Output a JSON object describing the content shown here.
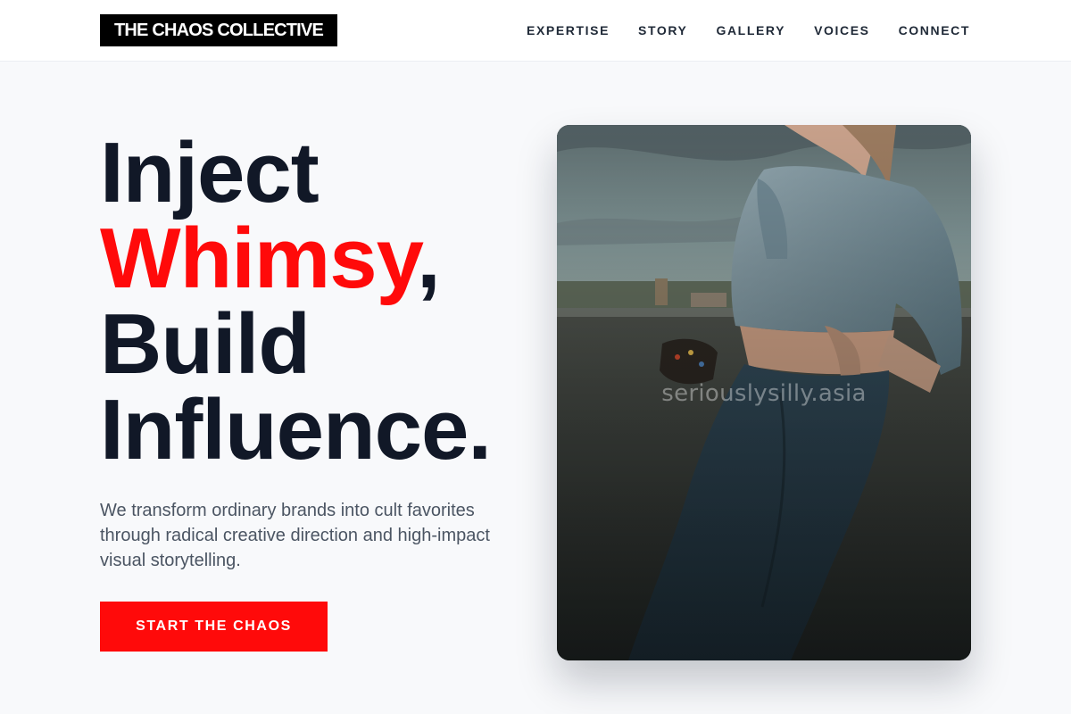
{
  "brand": {
    "name": "THE CHAOS COLLECTIVE"
  },
  "nav": {
    "items": [
      {
        "label": "EXPERTISE"
      },
      {
        "label": "STORY"
      },
      {
        "label": "GALLERY"
      },
      {
        "label": "VOICES"
      },
      {
        "label": "CONNECT"
      }
    ]
  },
  "hero": {
    "line1": "Inject",
    "accent_word": "Whimsy",
    "accent_suffix": ",",
    "line3": "Build",
    "line4": "Influence.",
    "description": "We transform ordinary brands into cult favorites through radical creative direction and high-impact visual storytelling.",
    "cta_label": "START THE CHAOS",
    "image_watermark": "seriouslysilly.asia"
  },
  "colors": {
    "accent": "#ff0a0a",
    "heading": "#111827",
    "body_text": "#4b5563",
    "page_bg": "#f8f9fb",
    "logo_bg": "#000000"
  }
}
